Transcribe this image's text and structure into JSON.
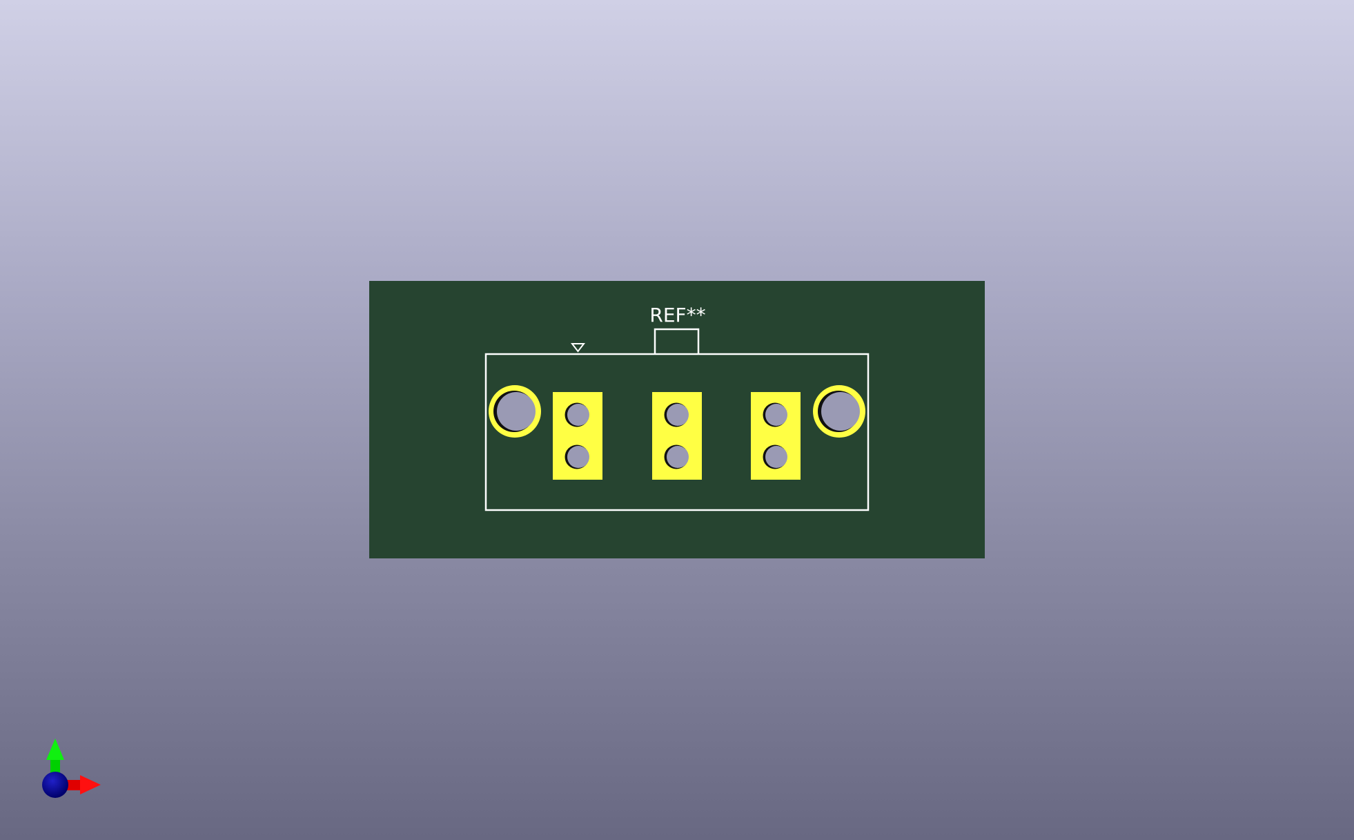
{
  "viewer": {
    "reference_label": "REF**",
    "colors": {
      "background_top": "#d0d0e6",
      "background_bottom": "#686882",
      "board": "#264430",
      "copper": "#ffff44",
      "silkscreen": "#ffffff",
      "hole": "#9a9ab4"
    },
    "axis_gizmo": {
      "x_color": "#ff0000",
      "y_color": "#00e000",
      "z_color": "#0000a0"
    },
    "pads": [
      {
        "type": "rect-2-hole"
      },
      {
        "type": "rect-2-hole"
      },
      {
        "type": "rect-2-hole"
      }
    ],
    "mounting_holes": [
      {
        "type": "ring"
      },
      {
        "type": "ring"
      }
    ]
  }
}
